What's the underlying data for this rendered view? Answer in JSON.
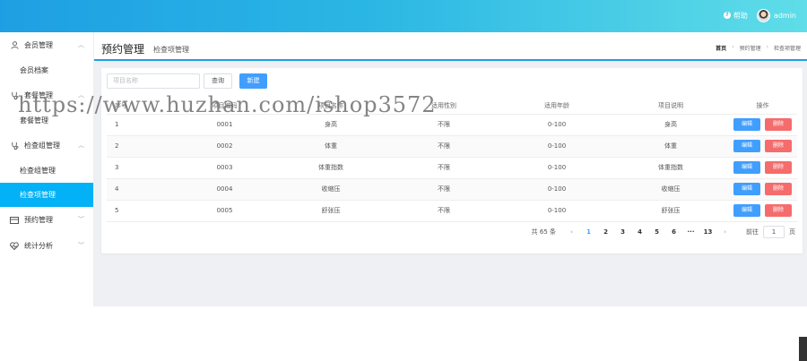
{
  "header": {
    "help_label": "帮助",
    "username": "admin",
    "help_icon_glyph": "?"
  },
  "sidebar": {
    "groups": [
      {
        "label": "会员管理",
        "icon": "user-icon",
        "items": [
          "会员档案"
        ]
      },
      {
        "label": "套餐管理",
        "icon": "stethoscope-icon",
        "items": [
          "套餐管理"
        ]
      },
      {
        "label": "检查组管理",
        "icon": "stethoscope-icon",
        "items": [
          "检查组管理",
          "检查项管理"
        ]
      },
      {
        "label": "预约管理",
        "icon": "calendar-icon",
        "items": []
      },
      {
        "label": "统计分析",
        "icon": "heart-pulse-icon",
        "items": []
      }
    ],
    "active_item": "检查项管理"
  },
  "page": {
    "title": "预约管理",
    "subtitle": "检查项管理",
    "breadcrumb": [
      "首页",
      "预约管理",
      "检查项管理"
    ]
  },
  "toolbar": {
    "search_placeholder": "项目名称",
    "query_label": "查询",
    "new_label": "新建"
  },
  "table": {
    "columns": [
      "序号",
      "项目编码",
      "项目名称",
      "适用性别",
      "适用年龄",
      "项目说明",
      "操作"
    ],
    "rows": [
      {
        "index": "1",
        "code": "0001",
        "name": "身高",
        "sex": "不限",
        "age": "0-100",
        "desc": "身高"
      },
      {
        "index": "2",
        "code": "0002",
        "name": "体重",
        "sex": "不限",
        "age": "0-100",
        "desc": "体重"
      },
      {
        "index": "3",
        "code": "0003",
        "name": "体重指数",
        "sex": "不限",
        "age": "0-100",
        "desc": "体重指数"
      },
      {
        "index": "4",
        "code": "0004",
        "name": "收缩压",
        "sex": "不限",
        "age": "0-100",
        "desc": "收缩压"
      },
      {
        "index": "5",
        "code": "0005",
        "name": "舒张压",
        "sex": "不限",
        "age": "0-100",
        "desc": "舒张压"
      }
    ],
    "edit_label": "编辑",
    "delete_label": "删除"
  },
  "pagination": {
    "total_text": "共 65 条",
    "pages": [
      "1",
      "2",
      "3",
      "4",
      "5",
      "6",
      "···",
      "13"
    ],
    "current_page": "1",
    "goto_label": "前往",
    "goto_value": "1",
    "page_unit": "页",
    "prev_glyph": "‹",
    "next_glyph": "›"
  },
  "watermark": "https://www.huzhan.com/ishop3572",
  "colors": {
    "primary": "#409eff",
    "danger": "#f56c6c",
    "active_menu": "#03b1f6"
  }
}
